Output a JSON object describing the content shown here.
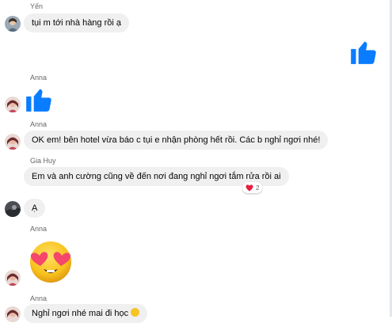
{
  "messages": [
    {
      "sender": "Yến",
      "text": "tụi m tới nhà hàng rồi ạ"
    },
    {
      "sender": "Anna",
      "text": "OK em! bên hotel vừa báo c tụi e nhận phòng hết rồi. Các b nghỉ ngơi nhé!"
    },
    {
      "sender": "Gia Huy",
      "text": "Em và anh cường cũng về đến nơi đang nghỉ ngơi tắm rửa rồi ai",
      "reaction_count": "2"
    },
    {
      "text": "Ạ"
    },
    {
      "sender": "Anna",
      "text": "Nghỉ ngơi nhé mai đi học"
    }
  ],
  "labels": {
    "anna_like_sender": "Anna",
    "anna_emoji_sender": "Anna"
  },
  "icons": {
    "like": "thumbs-up-icon",
    "reaction": "heart-icon",
    "sticker": "heart-eyes-emoji"
  },
  "colors": {
    "accent": "#0a7cff",
    "bubble": "#f0f0f0",
    "meta": "#65676b",
    "heart": "#e41e3f"
  }
}
